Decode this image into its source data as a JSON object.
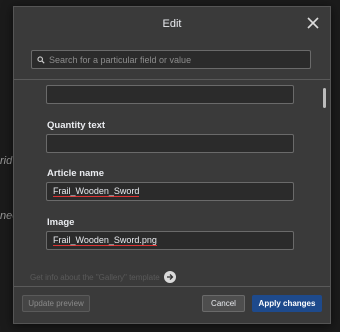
{
  "background": {
    "fragment_a": "rid I",
    "fragment_b": "nee"
  },
  "dialog": {
    "title": "Edit",
    "search": {
      "placeholder": "Search for a particular field or value"
    },
    "fields": [
      {
        "label": "Quantity text",
        "value": ""
      },
      {
        "label": "Article name",
        "value": "Frail_Wooden_Sword"
      },
      {
        "label": "Image",
        "value": "Frail_Wooden_Sword.png"
      }
    ],
    "template_link": "Get info about the \"Gallery\" template",
    "footer": {
      "update_preview": "Update preview",
      "cancel": "Cancel",
      "apply": "Apply changes"
    }
  },
  "colors": {
    "accent": "#1e4a8c",
    "dialog_bg": "#3a3a3a",
    "input_bg": "#2b2b2b",
    "spell_underline": "#d33"
  },
  "icons": [
    "close-icon",
    "search-icon",
    "arrow-right-icon"
  ]
}
